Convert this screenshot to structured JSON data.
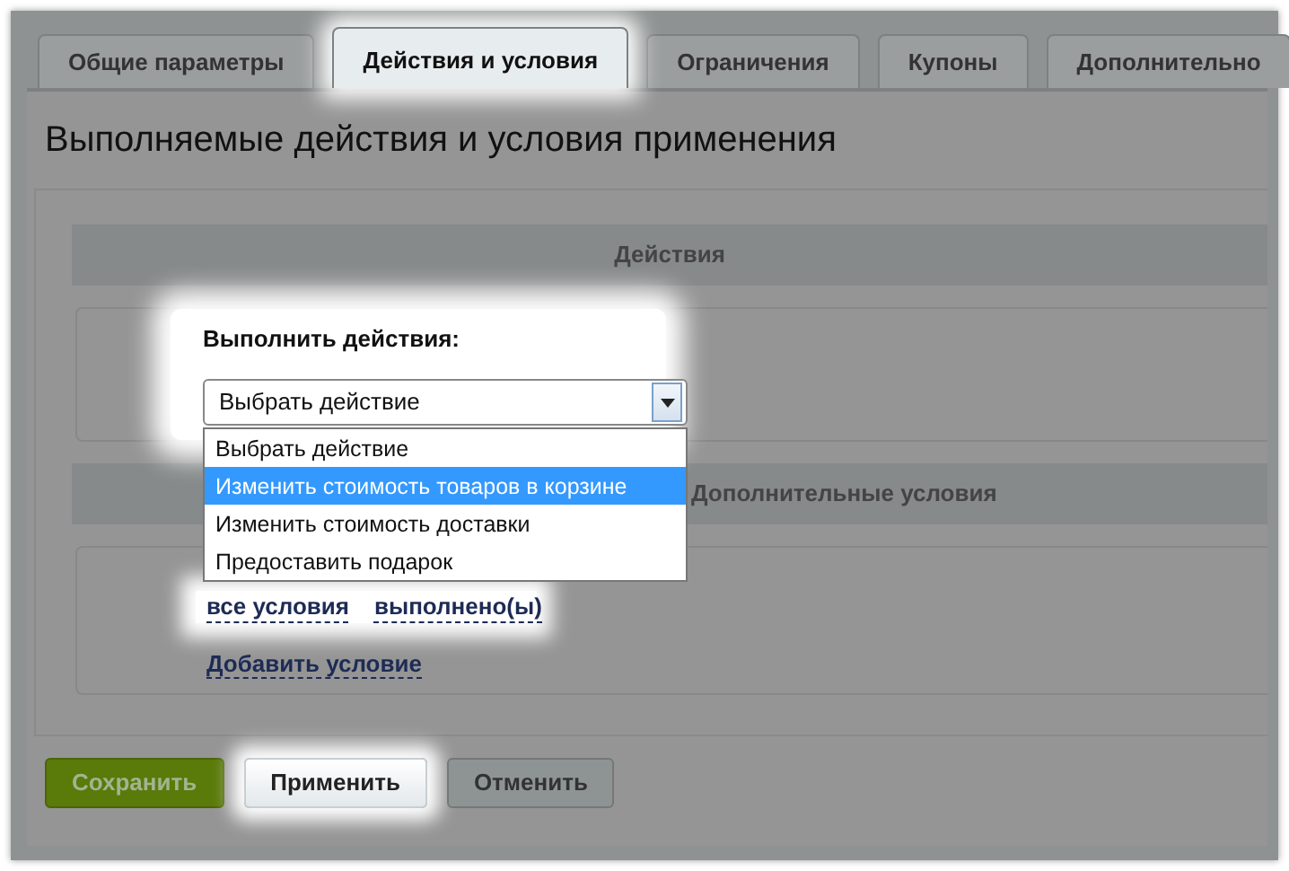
{
  "tabs": [
    {
      "label": "Общие параметры",
      "selected": false
    },
    {
      "label": "Действия и условия",
      "selected": true
    },
    {
      "label": "Ограничения",
      "selected": false
    },
    {
      "label": "Купоны",
      "selected": false
    },
    {
      "label": "Дополнительно",
      "selected": false
    }
  ],
  "title": "Выполняемые действия и условия применения",
  "actions_section": {
    "heading": "Действия",
    "label": "Выполнить действия:",
    "select": {
      "value": "Выбрать действие",
      "expanded": true,
      "options": [
        {
          "label": "Выбрать действие",
          "highlighted": false
        },
        {
          "label": "Изменить стоимость товаров в корзине",
          "highlighted": true
        },
        {
          "label": "Изменить стоимость доставки",
          "highlighted": false
        },
        {
          "label": "Предоставить подарок",
          "highlighted": false
        }
      ]
    }
  },
  "conditions_section": {
    "heading": "Дополнительные условия",
    "links": [
      "все условия",
      "выполнено(ы)"
    ],
    "add_link": "Добавить условие"
  },
  "buttons": [
    {
      "label": "Сохранить",
      "kind": "primary",
      "highlighted": false
    },
    {
      "label": "Применить",
      "kind": "default",
      "highlighted": true
    },
    {
      "label": "Отменить",
      "kind": "default",
      "highlighted": false
    }
  ]
}
